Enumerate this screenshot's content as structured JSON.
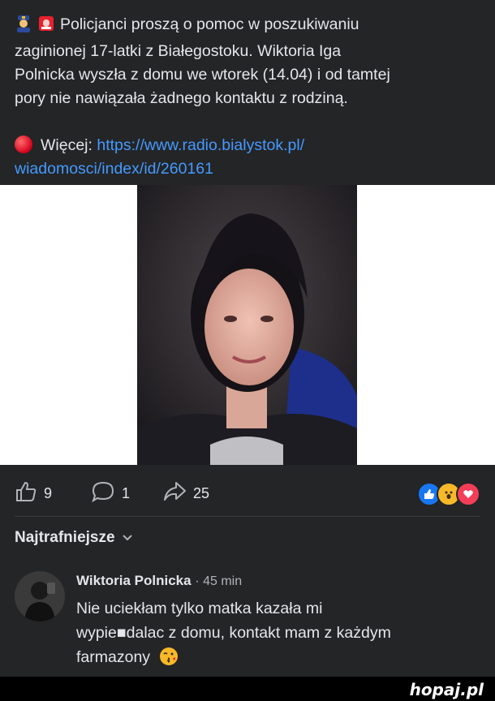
{
  "post": {
    "line1": "Policjanci proszą o pomoc w poszukiwaniu",
    "line2": "zaginionej 17-latki z Białegostoku. Wiktoria Iga",
    "line3": "Polnicka wyszła z domu we wtorek (14.04) i od tamtej",
    "line4": "pory nie nawiązała żadnego kontaktu z rodziną.",
    "more_label": "Więcej:",
    "link_line1": "https://www.radio.bialystok.pl/",
    "link_line2": "wiadomosci/index/id/260161",
    "icons": [
      "police-officer-icon",
      "siren-icon",
      "red-circle-icon"
    ]
  },
  "actions": {
    "likes": "9",
    "comments": "1",
    "shares": "25",
    "reactions": [
      "like-reaction",
      "wow-reaction",
      "love-reaction"
    ]
  },
  "comments_section": {
    "sort_label": "Najtrafniejsze",
    "comment": {
      "author": "Wiktoria Polnicka",
      "time": "· 45 min",
      "text_line1": "Nie uciekłam tylko matka kazała mi",
      "text_line2": "wypie■dalac z domu, kontakt mam z każdym",
      "text_line3": "farmazony"
    }
  },
  "watermark": "hopaj.pl",
  "colors": {
    "background": "#242526",
    "link": "#4599ff",
    "like_blue": "#1877f2",
    "love_red": "#f33e58"
  }
}
